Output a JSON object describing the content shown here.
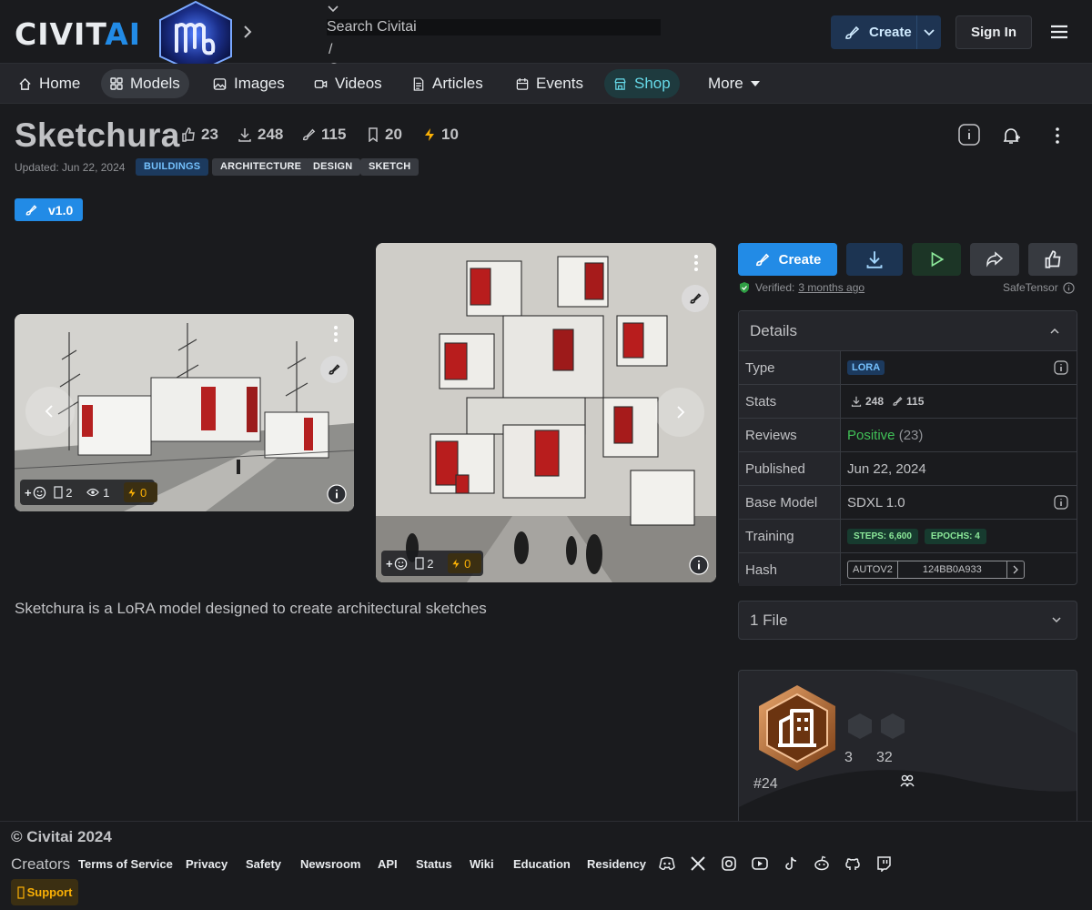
{
  "header": {
    "logo_text_a": "CIVIT",
    "logo_text_b": "AI",
    "search": {
      "placeholder": "Search Civitai",
      "shortcut": "/"
    },
    "create_label": "Create",
    "signin_label": "Sign In"
  },
  "nav": [
    {
      "label": "Home",
      "icon": "home-icon"
    },
    {
      "label": "Models",
      "icon": "grid-icon",
      "active": true
    },
    {
      "label": "Images",
      "icon": "photo-icon"
    },
    {
      "label": "Videos",
      "icon": "video-icon"
    },
    {
      "label": "Articles",
      "icon": "file-text-icon"
    },
    {
      "label": "Events",
      "icon": "calendar-icon"
    },
    {
      "label": "Shop",
      "icon": "shop-icon"
    },
    {
      "label": "More",
      "icon": "caret-down-icon"
    }
  ],
  "model": {
    "title": "Sketchura",
    "stats": {
      "likes": "23",
      "downloads": "248",
      "generations": "115",
      "bookmarks": "20",
      "buzz": "10"
    },
    "updated": "Updated: Jun 22, 2024",
    "tags": [
      "BUILDINGS",
      "ARCHITECTURE",
      "DESIGN",
      "SKETCH"
    ],
    "version": "v1.0",
    "description": "Sketchura is a LoRA model designed to create architectural sketches"
  },
  "images": [
    {
      "comments": "2",
      "views": "1",
      "buzz": "0",
      "plus": "+"
    },
    {
      "comments": "2",
      "buzz": "0",
      "plus": "+"
    }
  ],
  "actions": {
    "create_label": "Create"
  },
  "verified": {
    "label": "Verified:",
    "when": "3 months ago",
    "format": "SafeTensor"
  },
  "details": {
    "heading": "Details",
    "rows": {
      "type_label": "Type",
      "type_value": "LORA",
      "stats_label": "Stats",
      "stats_downloads": "248",
      "stats_generations": "115",
      "reviews_label": "Reviews",
      "reviews_sentiment": "Positive",
      "reviews_count": "(23)",
      "published_label": "Published",
      "published_value": "Jun 22, 2024",
      "base_label": "Base Model",
      "base_value": "SDXL 1.0",
      "training_label": "Training",
      "steps": "STEPS: 6,600",
      "epochs": "EPOCHS: 4",
      "hash_label": "Hash",
      "hash_type": "AUTOV2",
      "hash_value": "124BB0A933"
    }
  },
  "files": {
    "label": "1 File"
  },
  "creator": {
    "rank": "#24",
    "count_a": "3",
    "count_b": "32"
  },
  "footer": {
    "copyright": "© Civitai 2024",
    "creators": "Creators",
    "links": [
      "Terms of Service",
      "Privacy",
      "Safety",
      "Newsroom",
      "API",
      "Status",
      "Wiki",
      "Education",
      "Residency"
    ],
    "support": "Support"
  },
  "colors": {
    "accent": "#228be6",
    "background": "#1a1b1e",
    "positive": "#40c057",
    "buzz": "#fab005"
  }
}
